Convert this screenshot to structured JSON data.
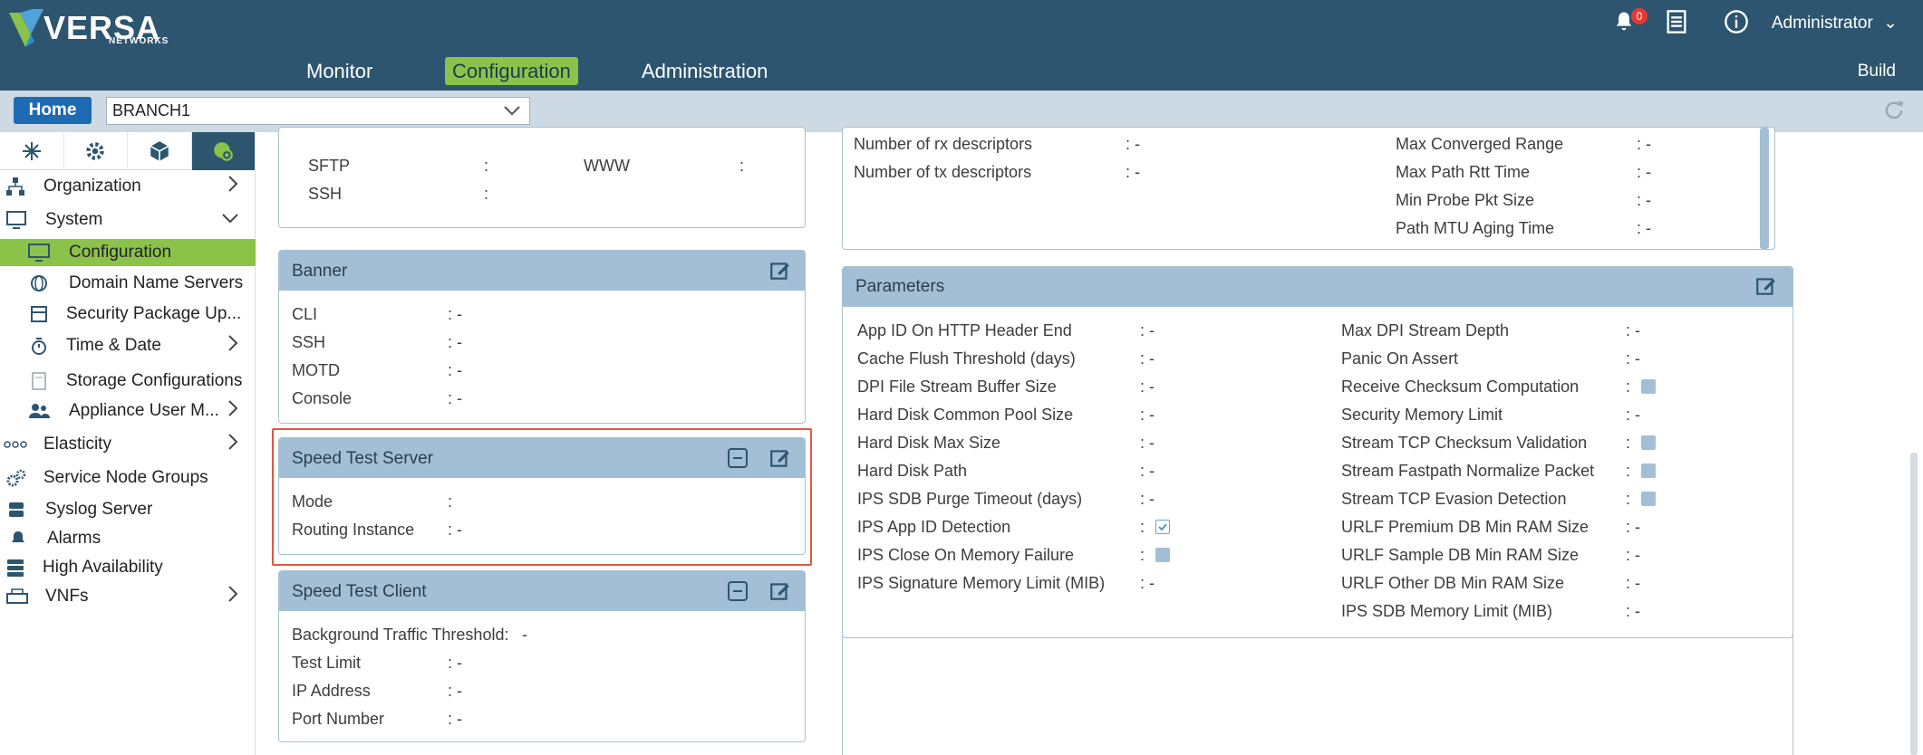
{
  "brand": {
    "name": "VERSA",
    "sub": "NETWORKS"
  },
  "nav": {
    "monitor": "Monitor",
    "configuration": "Configuration",
    "administration": "Administration"
  },
  "header": {
    "notifications_count": "0",
    "user": "Administrator",
    "build": "Build"
  },
  "subbar": {
    "home": "Home",
    "appliance": "BRANCH1"
  },
  "sidebar": {
    "organization": "Organization",
    "system": "System",
    "configuration": "Configuration",
    "dns": "Domain Name Servers",
    "security_pkg": "Security Package Up...",
    "time_date": "Time & Date",
    "storage": "Storage Configurations",
    "appliance_user": "Appliance User M...",
    "elasticity": "Elasticity",
    "service_node": "Service Node Groups",
    "syslog": "Syslog Server",
    "alarms": "Alarms",
    "ha": "High Availability",
    "vnfs": "VNFs"
  },
  "top_panel": {
    "sftp": "SFTP",
    "ssh": "SSH",
    "www": "WWW",
    "colon": ":"
  },
  "banner": {
    "title": "Banner",
    "rows": [
      {
        "label": "CLI",
        "value": ": -"
      },
      {
        "label": "SSH",
        "value": ": -"
      },
      {
        "label": "MOTD",
        "value": ": -"
      },
      {
        "label": "Console",
        "value": ": -"
      }
    ]
  },
  "speed_server": {
    "title": "Speed Test Server",
    "mode_label": "Mode",
    "mode_value": ":",
    "ri_label": "Routing Instance",
    "ri_value": ": -"
  },
  "speed_client": {
    "title": "Speed Test Client",
    "rows": [
      {
        "label": "Background Traffic Threshold:",
        "value": "-"
      },
      {
        "label": "Test Limit",
        "value": ": -"
      },
      {
        "label": "IP Address",
        "value": ": -"
      },
      {
        "label": "Port Number",
        "value": ": -"
      }
    ]
  },
  "interfaces_panel": {
    "left": [
      {
        "label": "Number of rx descriptors",
        "value": ": -"
      },
      {
        "label": "Number of tx descriptors",
        "value": ": -"
      }
    ],
    "right": [
      {
        "label": "Max Converged Range",
        "value": ": -"
      },
      {
        "label": "Max Path Rtt Time",
        "value": ": -"
      },
      {
        "label": "Min Probe Pkt Size",
        "value": ": -"
      },
      {
        "label": "Path MTU Aging Time",
        "value": ": -"
      }
    ]
  },
  "parameters": {
    "title": "Parameters",
    "left": [
      {
        "label": "App ID On HTTP Header End",
        "value": ": -"
      },
      {
        "label": "Cache Flush Threshold (days)",
        "value": ": -"
      },
      {
        "label": "DPI File Stream Buffer Size",
        "value": ": -"
      },
      {
        "label": "Hard Disk Common Pool Size",
        "value": ": -"
      },
      {
        "label": "Hard Disk Max Size",
        "value": ": -"
      },
      {
        "label": "Hard Disk Path",
        "value": ": -"
      },
      {
        "label": "IPS SDB Purge Timeout (days)",
        "value": ": -"
      },
      {
        "label": "IPS App ID Detection",
        "value": ":"
      },
      {
        "label": "IPS Close On Memory Failure",
        "value": ":"
      },
      {
        "label": "IPS Signature Memory Limit (MIB)",
        "value": ": -"
      }
    ],
    "right": [
      {
        "label": "Max DPI Stream Depth",
        "value": ": -"
      },
      {
        "label": "Panic On Assert",
        "value": ": -"
      },
      {
        "label": "Receive Checksum Computation",
        "value": ":"
      },
      {
        "label": "Security Memory Limit",
        "value": ": -"
      },
      {
        "label": "Stream TCP Checksum Validation",
        "value": ":"
      },
      {
        "label": "Stream Fastpath Normalize Packet",
        "value": ":"
      },
      {
        "label": "Stream TCP Evasion Detection",
        "value": ":"
      },
      {
        "label": "URLF Premium DB Min RAM Size",
        "value": ": -"
      },
      {
        "label": "URLF Sample DB Min RAM Size",
        "value": ": -"
      },
      {
        "label": "URLF Other DB Min RAM Size",
        "value": ": -"
      },
      {
        "label": "IPS SDB Memory Limit (MIB)",
        "value": ": -"
      }
    ]
  },
  "colors": {
    "header": "#2d5570",
    "accent": "#8bc34a",
    "panel_head": "#a3bfd5",
    "home": "#1e6ab3",
    "highlight": "#e05545"
  }
}
